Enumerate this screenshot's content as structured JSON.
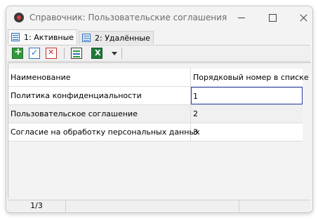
{
  "window": {
    "title": "Справочник: Пользовательские соглашения",
    "controls": [
      "minimize-icon",
      "maximize-icon",
      "close-icon"
    ]
  },
  "tabs": [
    {
      "label": "1: Активные",
      "icon": "list-icon",
      "active": true
    },
    {
      "label": "2: Удалённые",
      "icon": "list-icon",
      "active": false
    }
  ],
  "toolbar": {
    "buttons": [
      "add-record-icon",
      "edit-record-icon",
      "delete-record-icon",
      "properties-icon",
      "excel-export-icon",
      "dropdown-arrow-icon"
    ],
    "colors": {
      "add": "#2f9a3a",
      "edit": "#2f6fbf",
      "delete": "#c92a2a",
      "excel": "#1f7a3a"
    }
  },
  "table": {
    "columns": [
      "Наименование",
      "Порядковый номер в списке"
    ],
    "rows": [
      {
        "name": "Политика конфиденциальности",
        "order": "1",
        "selected": true
      },
      {
        "name": "Пользовательское соглашение",
        "order": "2",
        "selected": false
      },
      {
        "name": "Согласие на обработку персональных данных",
        "order": "3",
        "selected": false
      }
    ]
  },
  "status": {
    "position": "1/3"
  }
}
